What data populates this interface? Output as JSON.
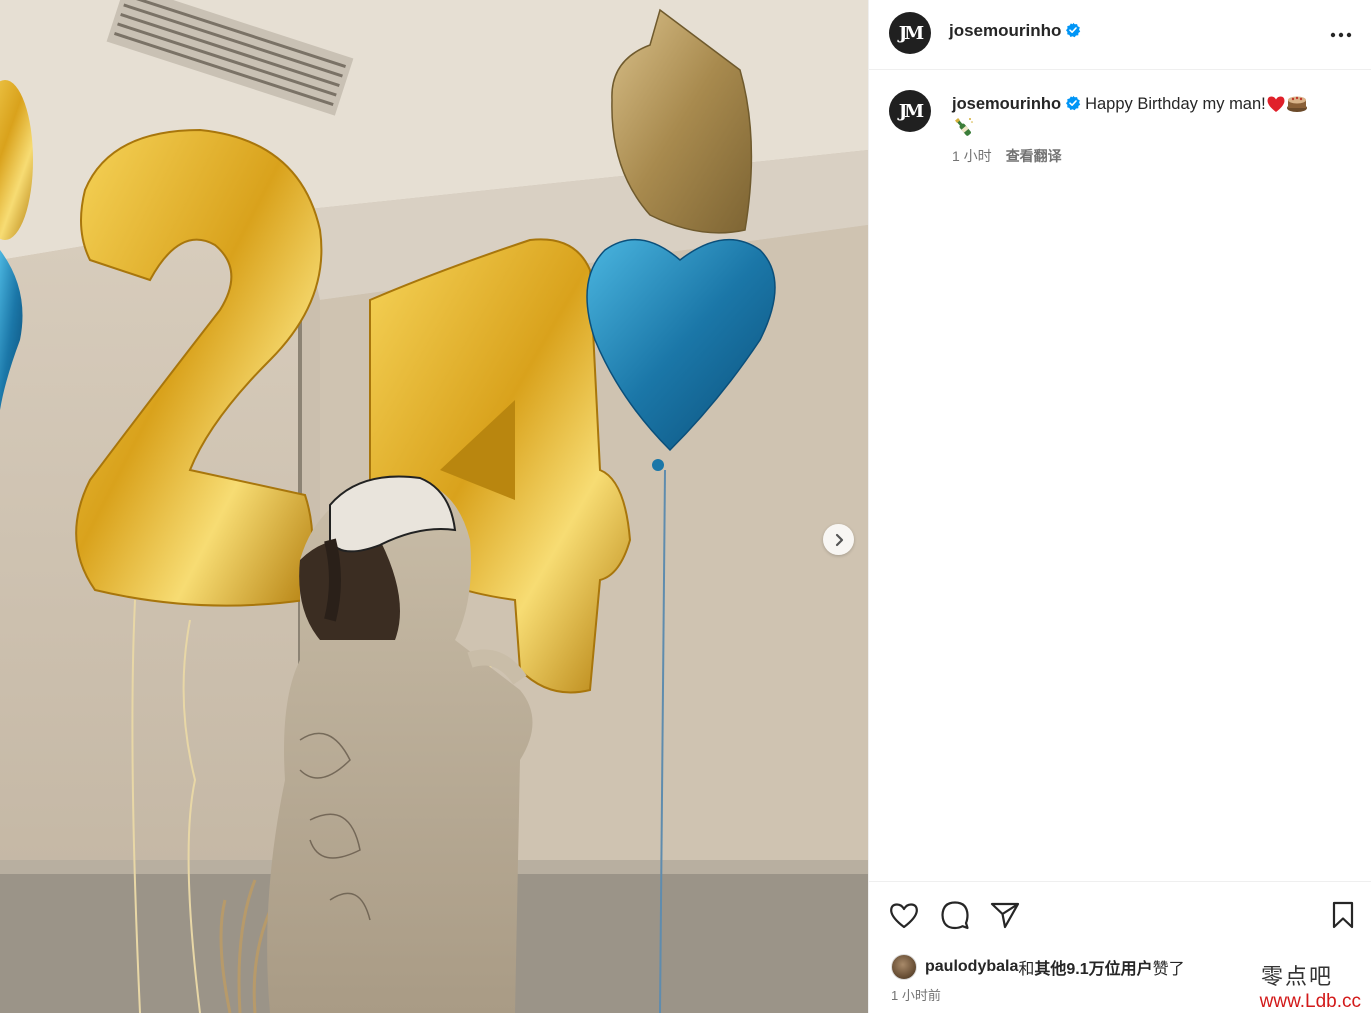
{
  "post": {
    "username": "josemourinho",
    "verified": true,
    "avatar_monogram": "JM"
  },
  "caption": {
    "username": "josemourinho",
    "text": "Happy Birthday my man!",
    "emojis": [
      "red-heart",
      "cake",
      "champagne"
    ],
    "age": "1 小时",
    "translate_label": "查看翻译"
  },
  "likes": {
    "first_user": "paulodybala",
    "connector": "和",
    "others": "其他9.1万位用户",
    "suffix": "赞了"
  },
  "timestamp": "1 小时前",
  "media": {
    "description_numbers": "24"
  },
  "watermark": {
    "line1": "零点吧",
    "line2": "www.Ldb.cc"
  },
  "colors": {
    "verified": "#0095f6",
    "text": "#262626",
    "muted": "#737373",
    "watermark_red": "#d21a1a"
  }
}
